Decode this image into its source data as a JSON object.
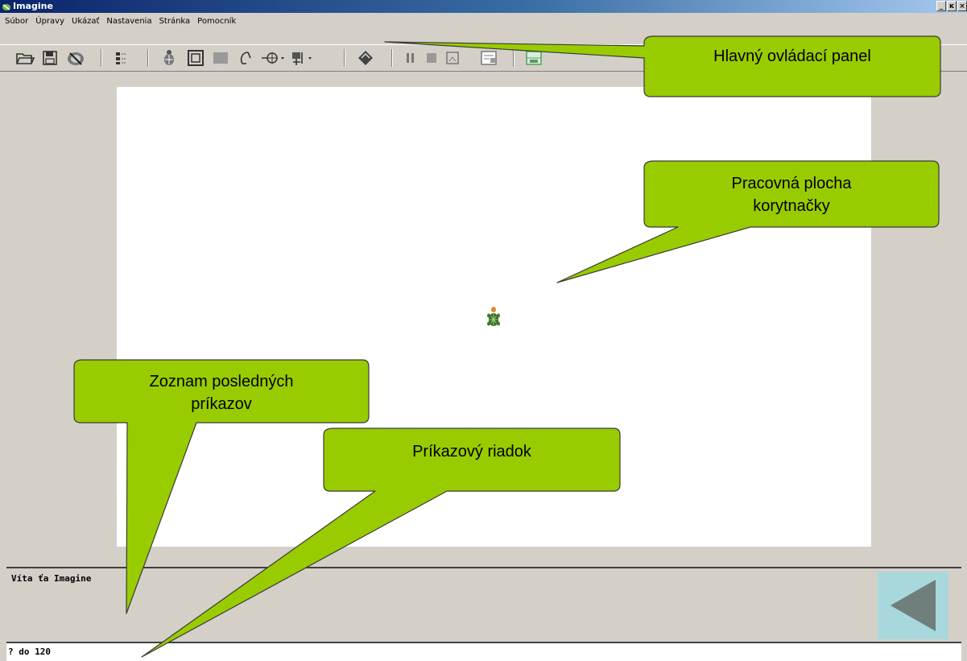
{
  "window": {
    "title": "Imagine",
    "controls": [
      "_",
      "ĸ",
      "×"
    ]
  },
  "menu": {
    "items": [
      "Súbor",
      "Úpravy",
      "Ukázať",
      "Nastavenia",
      "Stránka",
      "Pomocník"
    ]
  },
  "toolbar": {
    "icons": [
      "open-folder-icon",
      "save-disk-icon",
      "print-icon",
      "list-icon",
      "turtle-icon",
      "frame-icon",
      "rectangle-icon",
      "pen-icon",
      "target-icon",
      "tool-dropdown-icon",
      "run-icon",
      "pause-icon",
      "stop-icon",
      "step-icon",
      "page-icon",
      "grid-icon"
    ]
  },
  "history": {
    "lines": [
      "Víta ťa Imagine"
    ]
  },
  "command_line": {
    "text": "? do 120"
  },
  "callouts": {
    "main_panel": "Hlavný ovládací panel",
    "canvas_line1": "Pracovná plocha",
    "canvas_line2": "korytnačky",
    "history_line1": "Zoznam posledných",
    "history_line2": "príkazov",
    "command": "Príkazový riadok"
  },
  "colors": {
    "callout_fill": "#99cc00",
    "titlebar_start": "#0a246a",
    "back_button": "#a9d8dc",
    "back_arrow": "#6e7f7c"
  }
}
